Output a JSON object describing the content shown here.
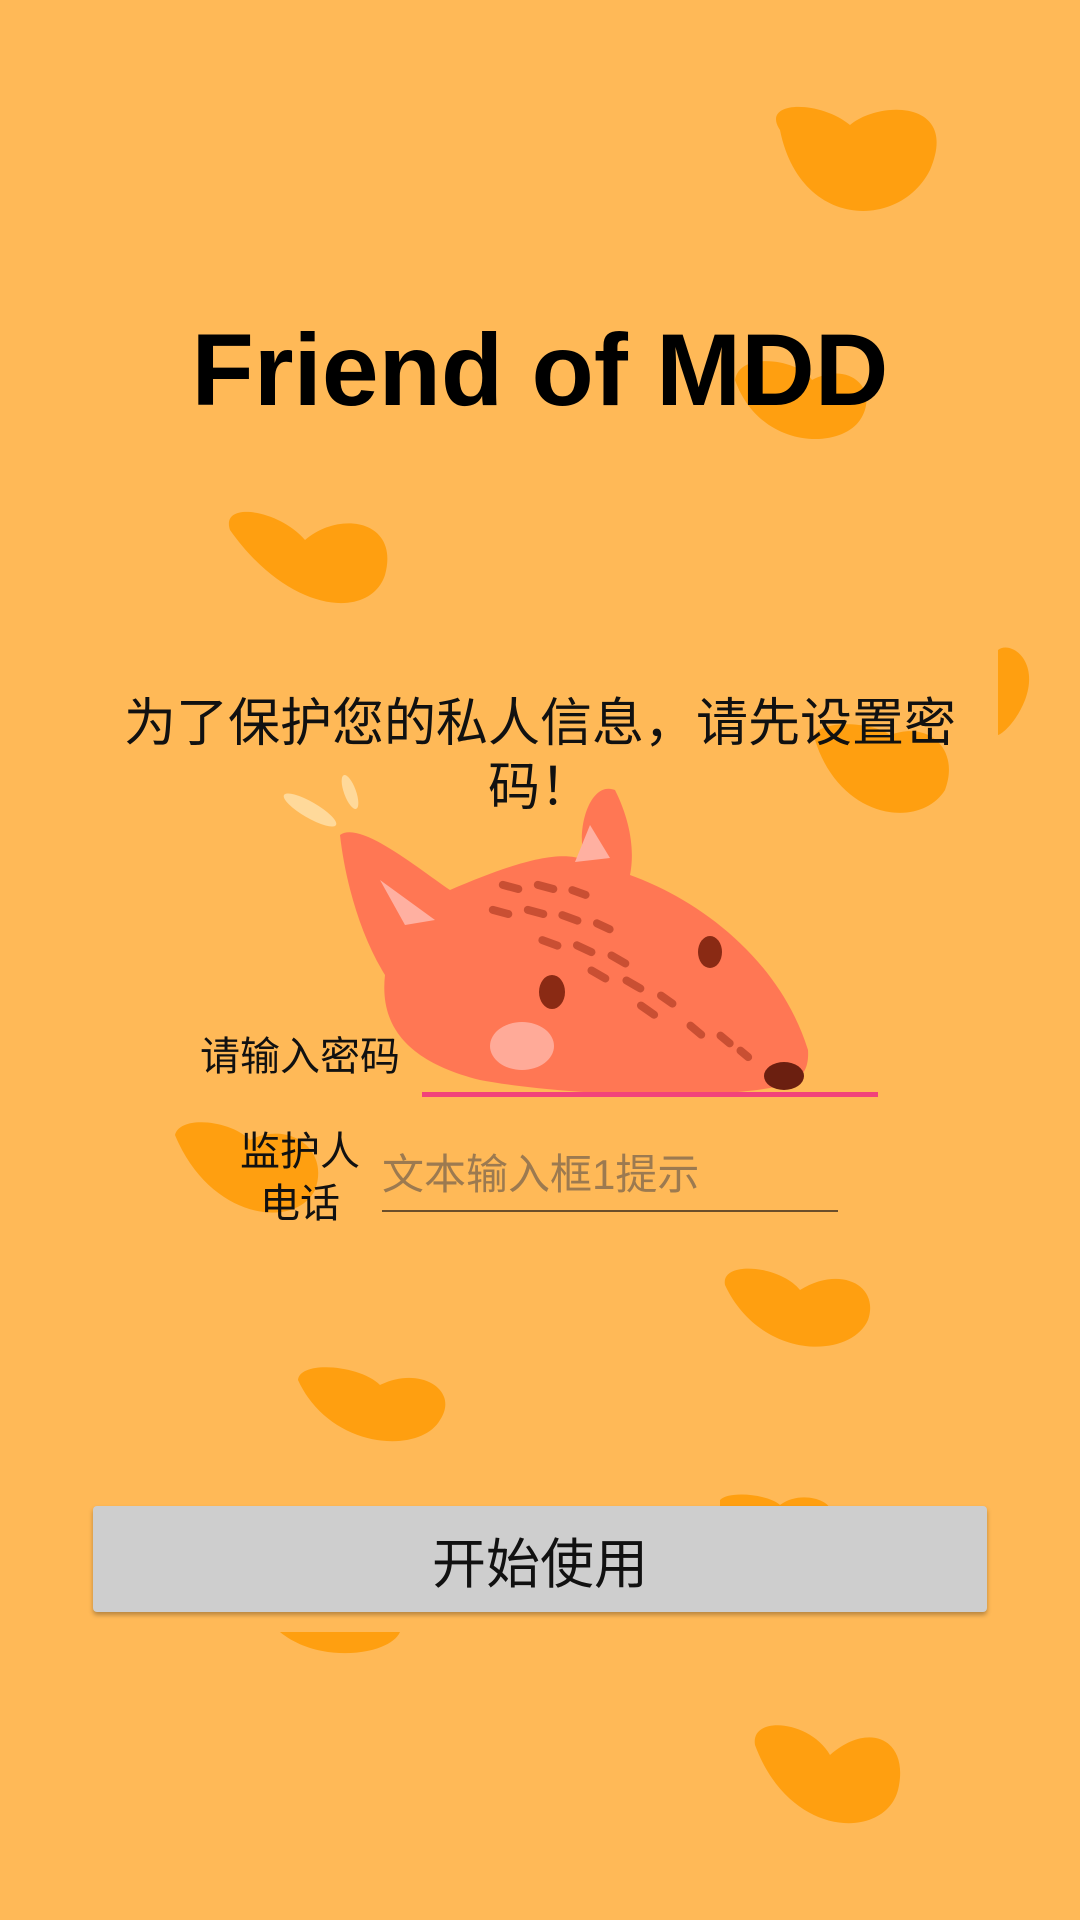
{
  "app": {
    "title": "Friend of MDD"
  },
  "intro": {
    "message": "为了保护您的私人信息，请先设置密码！"
  },
  "password": {
    "label": "请输入密码",
    "value": "",
    "placeholder": ""
  },
  "guardian_phone": {
    "label": "监护人电话",
    "value": "",
    "placeholder": "文本输入框1提示"
  },
  "actions": {
    "start_label": "开始使用"
  },
  "colors": {
    "background": "#ffb957",
    "heart": "#ff9f10",
    "accent_underline": "#f2437a",
    "button": "#cecece"
  },
  "illustration": {
    "background_icons": [
      "heart-icon"
    ],
    "mascot": "fox-illustration"
  }
}
